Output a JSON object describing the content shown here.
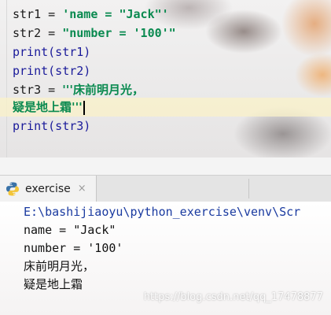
{
  "editor": {
    "lines": [
      {
        "id": "str1",
        "op": " = ",
        "string": "'name = \"Jack\"'"
      },
      {
        "id": "str2",
        "op": " = ",
        "string": "\"number = '100'\""
      },
      {
        "fn": "print",
        "arg": "(str1)"
      },
      {
        "fn": "print",
        "arg": "(str2)"
      },
      {
        "id": "str3",
        "op": " = ",
        "string": "'''床前明月光，"
      },
      {
        "string": "疑是地上霜'''"
      },
      {
        "fn": "print",
        "arg": "(str3)"
      }
    ]
  },
  "run_tab": {
    "label": "exercise",
    "close": "×",
    "icon": "python-icon"
  },
  "console": {
    "lines": [
      "E:\\bashijiaoyu\\python_exercise\\venv\\Scr",
      "name = \"Jack\"",
      "number = '100'",
      "床前明月光，",
      "疑是地上霜"
    ]
  },
  "watermark": "https://blog.csdn.net/qq_17478877"
}
